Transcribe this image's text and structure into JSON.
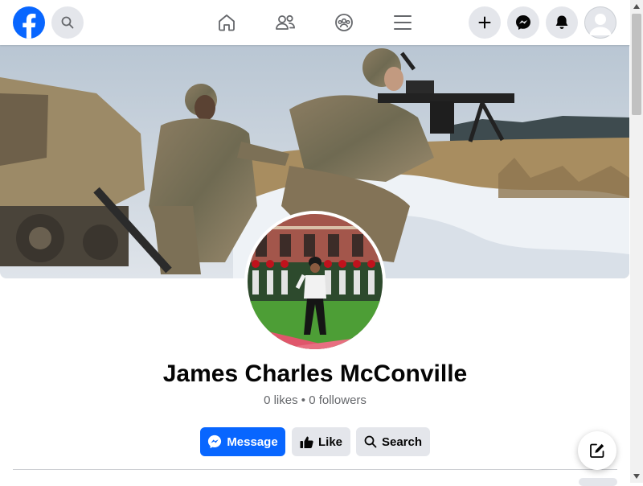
{
  "header": {
    "logo_icon": "facebook-logo-icon",
    "search_icon": "search-icon",
    "nav": [
      "home-icon",
      "friends-icon",
      "groups-icon",
      "menu-icon"
    ],
    "actions": [
      "plus-icon",
      "messenger-icon",
      "bell-icon",
      "avatar"
    ]
  },
  "profile": {
    "name": "James Charles McConville",
    "likes": "0 likes",
    "separator": " • ",
    "followers": "0 followers"
  },
  "buttons": {
    "message": "Message",
    "like": "Like",
    "search": "Search"
  },
  "compose_icon": "compose-icon",
  "colors": {
    "brand": "#0866ff",
    "secondary_button": "#e4e6eb",
    "text_primary": "#050505",
    "text_secondary": "#65676b"
  }
}
